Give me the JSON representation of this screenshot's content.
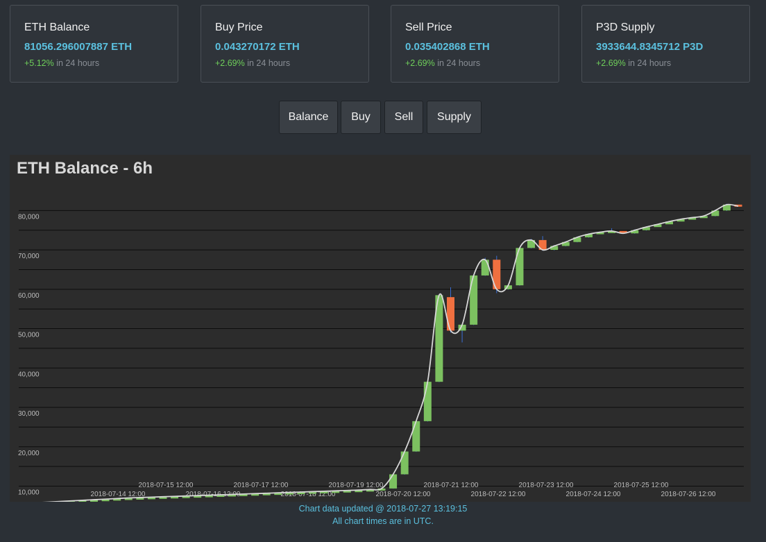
{
  "cards": [
    {
      "label": "ETH Balance",
      "value": "81056.296007887 ETH",
      "change": "+5.12%",
      "suffix": "in 24 hours"
    },
    {
      "label": "Buy Price",
      "value": "0.043270172 ETH",
      "change": "+2.69%",
      "suffix": "in 24 hours"
    },
    {
      "label": "Sell Price",
      "value": "0.035402868 ETH",
      "change": "+2.69%",
      "suffix": "in 24 hours"
    },
    {
      "label": "P3D Supply",
      "value": "3933644.8345712 P3D",
      "change": "+2.69%",
      "suffix": "in 24 hours"
    }
  ],
  "buttons": [
    "Balance",
    "Buy",
    "Sell",
    "Supply"
  ],
  "footer": {
    "updated": "Chart data updated @ 2018-07-27 13:19:15",
    "timezone": "All chart times are in UTC."
  },
  "colors": {
    "up": "#7cc160",
    "down": "#f07040",
    "wick": "#3b6fd6",
    "line": "#d8d8d8",
    "accent": "#5bc0de"
  },
  "chart_data": {
    "type": "candlestick",
    "title": "ETH Balance - 6h",
    "ylim": [
      10000,
      82000
    ],
    "yticks": [
      10000,
      20000,
      30000,
      40000,
      50000,
      60000,
      70000,
      80000
    ],
    "ytick_labels": [
      "10,000",
      "20,000",
      "30,000",
      "40,000",
      "50,000",
      "60,000",
      "70,000",
      "80,000"
    ],
    "grid": true,
    "xticks_upper": [
      "2018-07-15 12:00",
      "2018-07-17 12:00",
      "2018-07-19 12:00",
      "2018-07-21 12:00",
      "2018-07-23 12:00",
      "2018-07-25 12:00"
    ],
    "xticks_lower": [
      "2018-07-14 12:00",
      "2018-07-16 12:00",
      "2018-07-18 12:00",
      "2018-07-20 12:00",
      "2018-07-22 12:00",
      "2018-07-24 12:00",
      "2018-07-26 12:00"
    ],
    "candles": [
      {
        "o": 5400,
        "c": 5600,
        "h": 5650,
        "l": 5350
      },
      {
        "o": 5600,
        "c": 5800,
        "h": 5850,
        "l": 5550
      },
      {
        "o": 5800,
        "c": 5950,
        "h": 6000,
        "l": 5750
      },
      {
        "o": 5950,
        "c": 6100,
        "h": 6150,
        "l": 5900
      },
      {
        "o": 6100,
        "c": 6250,
        "h": 6300,
        "l": 6050
      },
      {
        "o": 6250,
        "c": 6400,
        "h": 6450,
        "l": 6200
      },
      {
        "o": 6400,
        "c": 6550,
        "h": 6600,
        "l": 6350
      },
      {
        "o": 6550,
        "c": 6700,
        "h": 6750,
        "l": 6500
      },
      {
        "o": 6700,
        "c": 6850,
        "h": 6900,
        "l": 6650
      },
      {
        "o": 6850,
        "c": 7000,
        "h": 7050,
        "l": 6800
      },
      {
        "o": 7000,
        "c": 7100,
        "h": 7150,
        "l": 6950
      },
      {
        "o": 7100,
        "c": 7200,
        "h": 7250,
        "l": 7050
      },
      {
        "o": 7200,
        "c": 7300,
        "h": 7350,
        "l": 7150
      },
      {
        "o": 7300,
        "c": 7400,
        "h": 7450,
        "l": 7250
      },
      {
        "o": 7400,
        "c": 7500,
        "h": 7550,
        "l": 7350
      },
      {
        "o": 7500,
        "c": 7600,
        "h": 7650,
        "l": 7450
      },
      {
        "o": 7600,
        "c": 7700,
        "h": 7750,
        "l": 7550
      },
      {
        "o": 7700,
        "c": 7800,
        "h": 7850,
        "l": 7650
      },
      {
        "o": 7800,
        "c": 7900,
        "h": 7950,
        "l": 7750
      },
      {
        "o": 7900,
        "c": 8000,
        "h": 8050,
        "l": 7850
      },
      {
        "o": 8000,
        "c": 8100,
        "h": 8150,
        "l": 7950
      },
      {
        "o": 8100,
        "c": 8200,
        "h": 8250,
        "l": 8050
      },
      {
        "o": 8200,
        "c": 8300,
        "h": 8350,
        "l": 8150
      },
      {
        "o": 8300,
        "c": 8400,
        "h": 8450,
        "l": 8250
      },
      {
        "o": 8400,
        "c": 8500,
        "h": 8550,
        "l": 8350
      },
      {
        "o": 8500,
        "c": 8600,
        "h": 8650,
        "l": 8450
      },
      {
        "o": 8600,
        "c": 8700,
        "h": 8750,
        "l": 8550
      },
      {
        "o": 8700,
        "c": 8800,
        "h": 8850,
        "l": 8650
      },
      {
        "o": 8800,
        "c": 8900,
        "h": 8950,
        "l": 8750
      },
      {
        "o": 8900,
        "c": 9000,
        "h": 9050,
        "l": 8850
      },
      {
        "o": 9000,
        "c": 9150,
        "h": 9200,
        "l": 8950
      },
      {
        "o": 9150,
        "c": 9400,
        "h": 9450,
        "l": 9100
      },
      {
        "o": 9400,
        "c": 13000,
        "h": 13100,
        "l": 9350
      },
      {
        "o": 13000,
        "c": 18800,
        "h": 18900,
        "l": 12900
      },
      {
        "o": 18800,
        "c": 26500,
        "h": 26600,
        "l": 18700
      },
      {
        "o": 26500,
        "c": 36500,
        "h": 36600,
        "l": 26400
      },
      {
        "o": 36500,
        "c": 58500,
        "h": 58700,
        "l": 36400
      },
      {
        "o": 58000,
        "c": 49500,
        "h": 60500,
        "l": 49000
      },
      {
        "o": 49500,
        "c": 51000,
        "h": 51200,
        "l": 46500
      },
      {
        "o": 51000,
        "c": 63500,
        "h": 63700,
        "l": 50900
      },
      {
        "o": 63500,
        "c": 67500,
        "h": 68000,
        "l": 63400
      },
      {
        "o": 67500,
        "c": 60000,
        "h": 68500,
        "l": 59000
      },
      {
        "o": 60000,
        "c": 61000,
        "h": 61200,
        "l": 59900
      },
      {
        "o": 61000,
        "c": 70500,
        "h": 70700,
        "l": 60900
      },
      {
        "o": 70500,
        "c": 72500,
        "h": 72800,
        "l": 70400
      },
      {
        "o": 72500,
        "c": 70000,
        "h": 73500,
        "l": 69800
      },
      {
        "o": 70000,
        "c": 71000,
        "h": 71200,
        "l": 69900
      },
      {
        "o": 71000,
        "c": 72000,
        "h": 72200,
        "l": 70900
      },
      {
        "o": 72000,
        "c": 73200,
        "h": 73400,
        "l": 71900
      },
      {
        "o": 73200,
        "c": 74000,
        "h": 74200,
        "l": 73100
      },
      {
        "o": 74000,
        "c": 74500,
        "h": 74700,
        "l": 73900
      },
      {
        "o": 74500,
        "c": 74800,
        "h": 75500,
        "l": 74400
      },
      {
        "o": 74800,
        "c": 74200,
        "h": 75000,
        "l": 74000
      },
      {
        "o": 74200,
        "c": 75000,
        "h": 75200,
        "l": 74100
      },
      {
        "o": 75000,
        "c": 75800,
        "h": 76000,
        "l": 74900
      },
      {
        "o": 75800,
        "c": 76500,
        "h": 76700,
        "l": 75700
      },
      {
        "o": 76500,
        "c": 77200,
        "h": 77400,
        "l": 76400
      },
      {
        "o": 77200,
        "c": 77800,
        "h": 78000,
        "l": 77100
      },
      {
        "o": 77800,
        "c": 78200,
        "h": 78400,
        "l": 77700
      },
      {
        "o": 78200,
        "c": 78600,
        "h": 78800,
        "l": 78100
      },
      {
        "o": 78600,
        "c": 80000,
        "h": 80200,
        "l": 78500
      },
      {
        "o": 80000,
        "c": 81500,
        "h": 81700,
        "l": 79900
      },
      {
        "o": 81500,
        "c": 81100,
        "h": 81700,
        "l": 81000
      }
    ]
  }
}
